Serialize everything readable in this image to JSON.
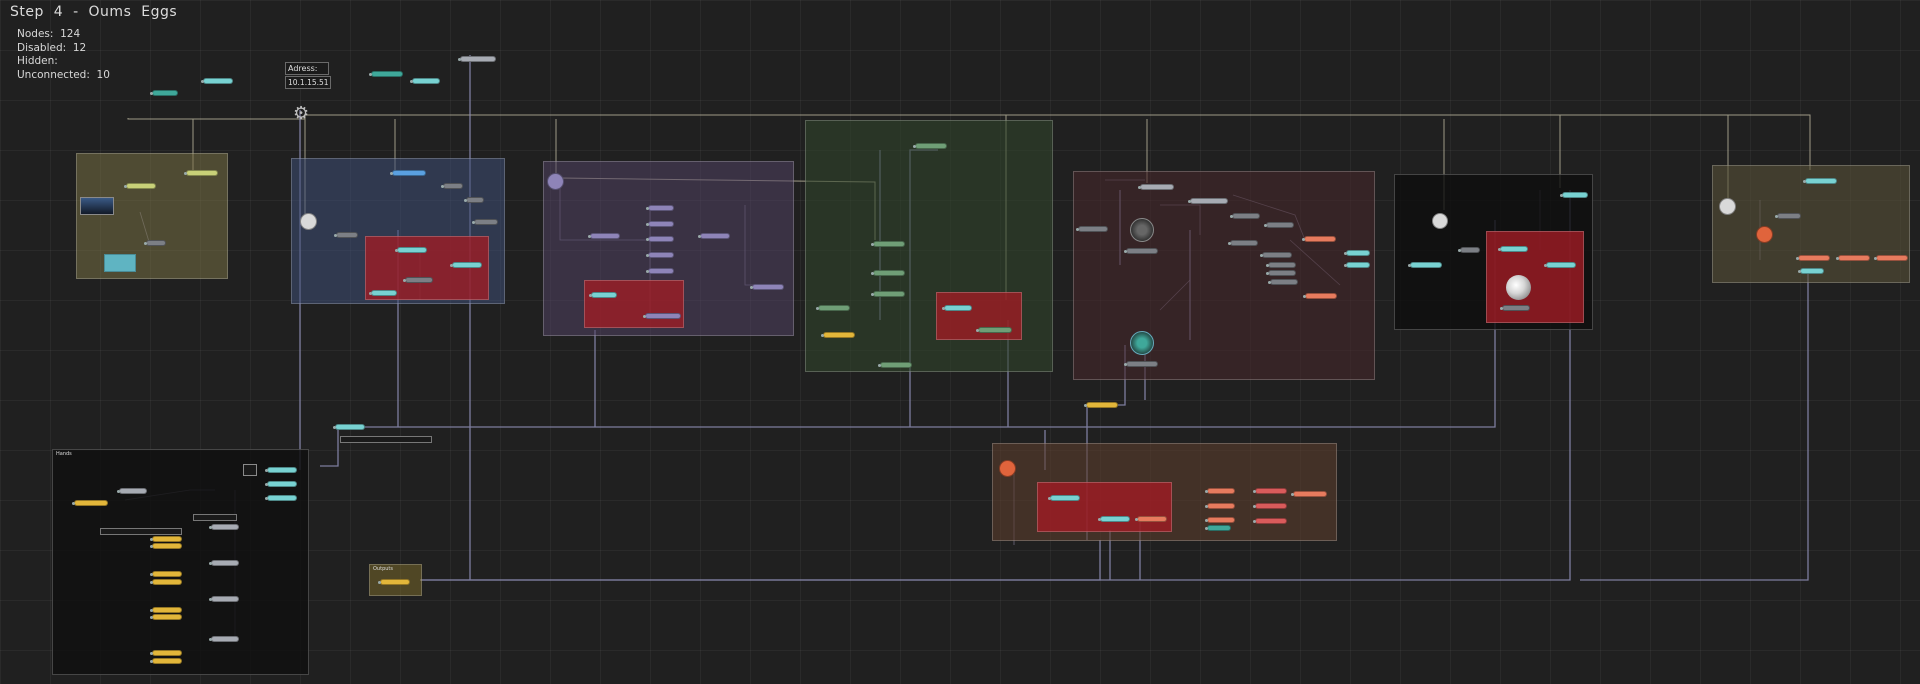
{
  "header": {
    "title": "Step  4  -  Oums  Eggs"
  },
  "stats": {
    "nodes_label": "Nodes:",
    "nodes_value": "124",
    "disabled_label": "Disabled:",
    "disabled_value": "12",
    "hidden_label": "Hidden:",
    "hidden_value": "",
    "unconnected_label": "Unconnected:",
    "unconnected_value": "10"
  },
  "address": {
    "label": "Adress:",
    "value": "10.1.15.51"
  },
  "frames": {
    "hands_label": "Hands",
    "outputs_label": "Outputs"
  },
  "colors": {
    "background": "#202020",
    "frame_olive": "#5b5838",
    "frame_blue": "#3b4a6a",
    "frame_purple": "#4a3f5a",
    "frame_green": "#34452f",
    "frame_maroon": "#4a2f33",
    "frame_black": "#151515",
    "frame_brown": "#5b3e2d",
    "frame_red": "#8a1f25",
    "wire_main": "#8d8db5",
    "wire_light": "#c9c3a8"
  }
}
